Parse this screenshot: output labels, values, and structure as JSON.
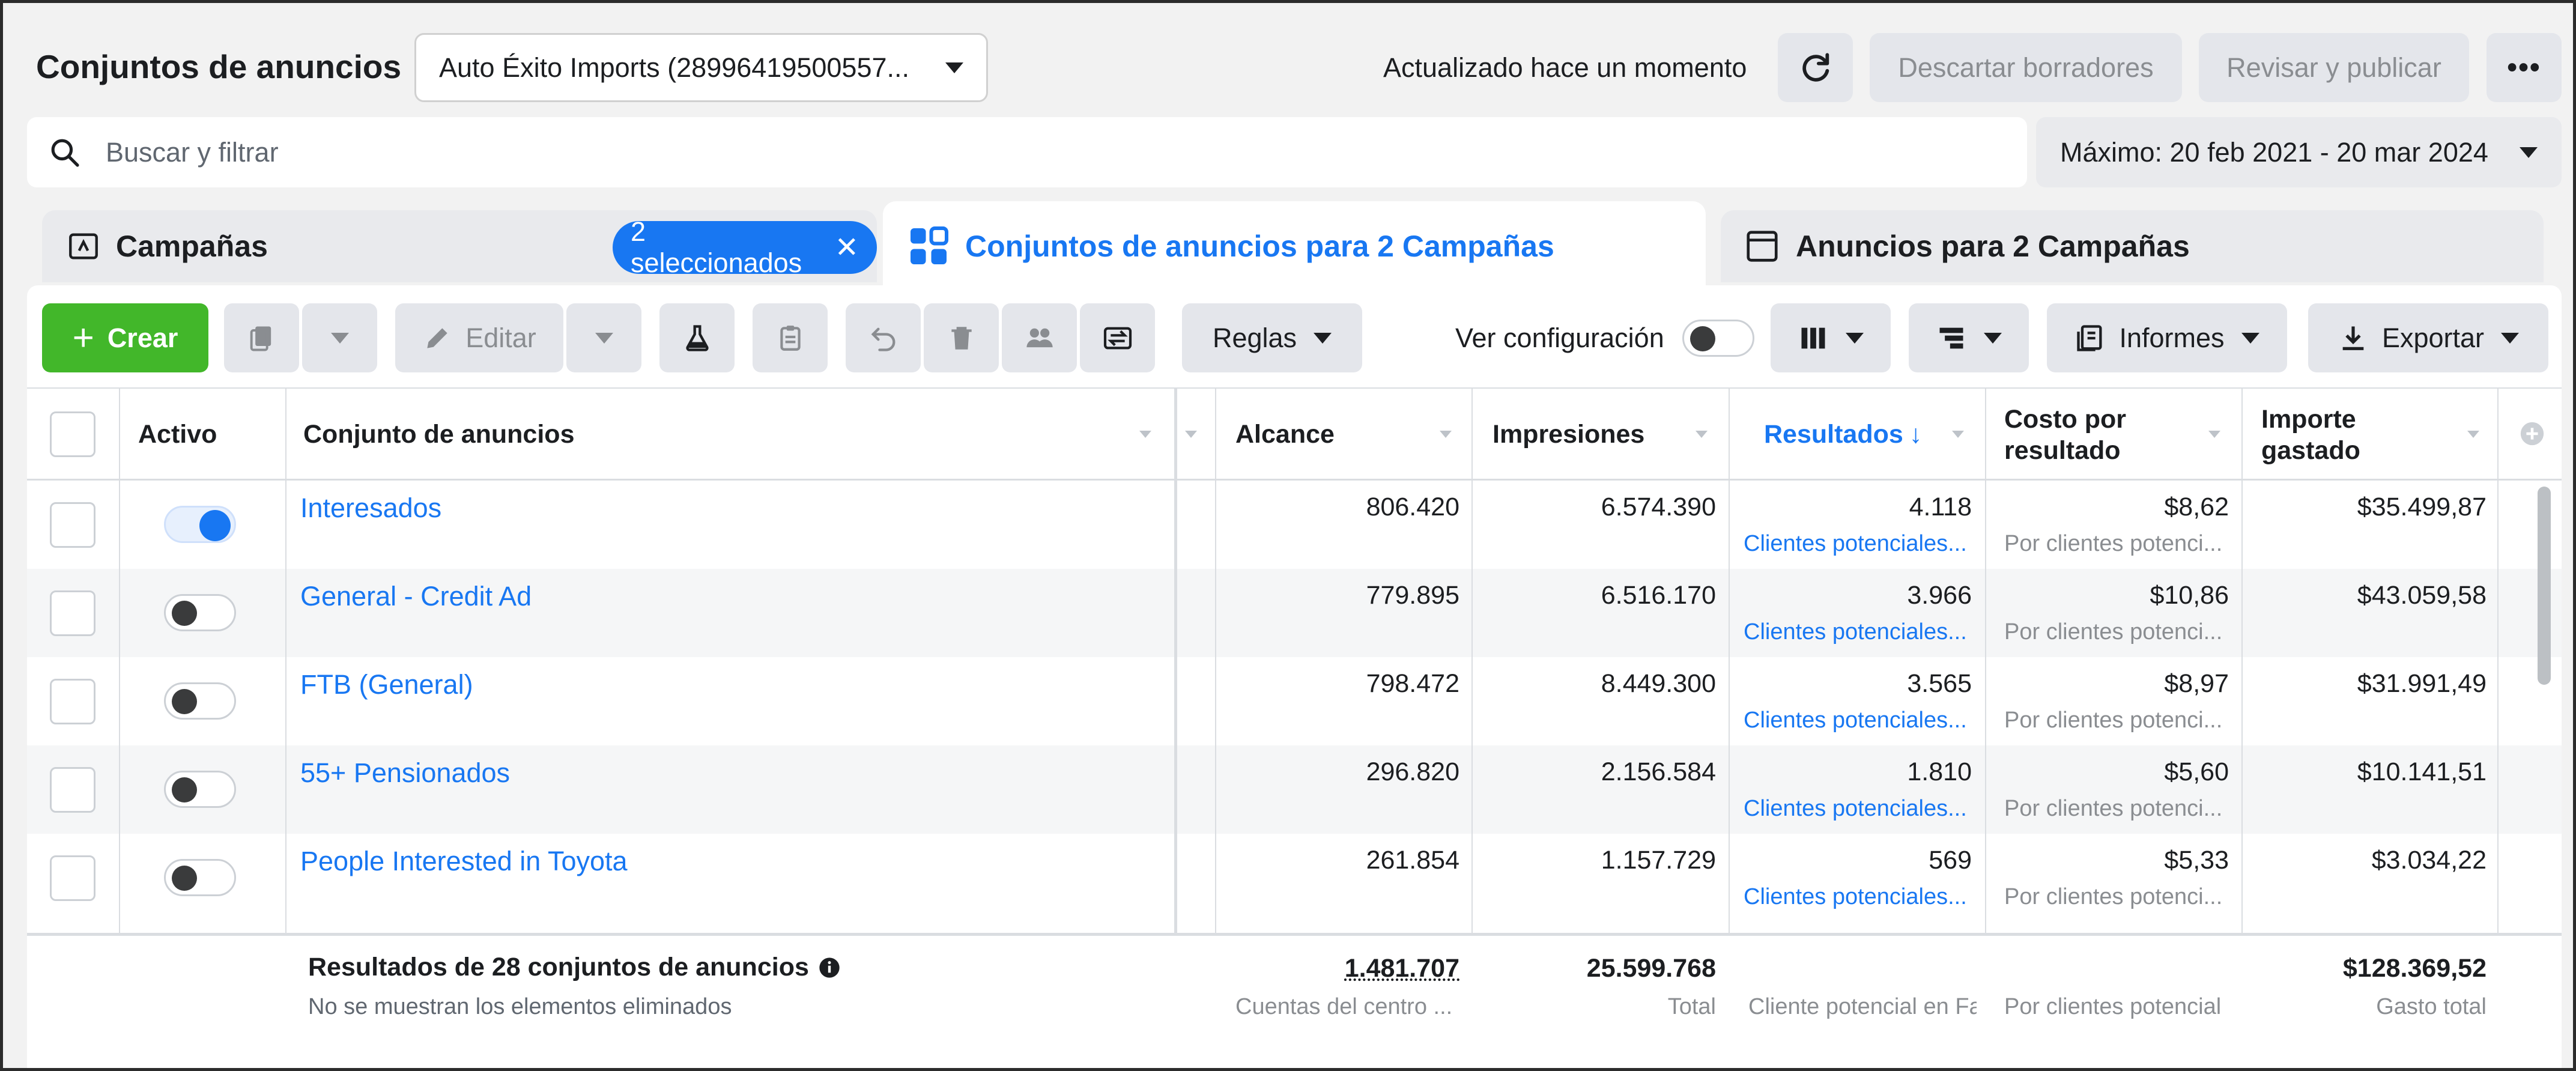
{
  "header": {
    "title": "Conjuntos de anuncios",
    "account": "Auto Éxito Imports (28996419500557...",
    "updated": "Actualizado hace un momento",
    "discard_label": "Descartar borradores",
    "publish_label": "Revisar y publicar"
  },
  "search": {
    "placeholder": "Buscar y filtrar",
    "date_range": "Máximo: 20 feb 2021 - 20 mar 2024"
  },
  "tabs": {
    "campaigns": "Campañas",
    "selected_chip": "2 seleccionados",
    "adsets": "Conjuntos de anuncios para 2 Campañas",
    "ads": "Anuncios para 2 Campañas"
  },
  "toolbar": {
    "create": "Crear",
    "edit": "Editar",
    "rules": "Reglas",
    "view_setup": "Ver configuración",
    "reports": "Informes",
    "export": "Exportar"
  },
  "columns": {
    "active": "Activo",
    "adset": "Conjunto de anuncios",
    "reach": "Alcance",
    "impressions": "Impresiones",
    "results": "Resultados",
    "cost_l1": "Costo por",
    "cost_l2": "resultado",
    "spent_l1": "Importe",
    "spent_l2": "gastado"
  },
  "rows": [
    {
      "active": true,
      "name": "Interesados",
      "reach": "806.420",
      "impressions": "6.574.390",
      "results": "4.118",
      "results_sub": "Clientes potenciales...",
      "cost": "$8,62",
      "cost_sub": "Por clientes potenci...",
      "spent": "$35.499,87"
    },
    {
      "active": false,
      "name": "General - Credit Ad",
      "reach": "779.895",
      "impressions": "6.516.170",
      "results": "3.966",
      "results_sub": "Clientes potenciales...",
      "cost": "$10,86",
      "cost_sub": "Por clientes potenci...",
      "spent": "$43.059,58"
    },
    {
      "active": false,
      "name": "FTB (General)",
      "reach": "798.472",
      "impressions": "8.449.300",
      "results": "3.565",
      "results_sub": "Clientes potenciales...",
      "cost": "$8,97",
      "cost_sub": "Por clientes potenci...",
      "spent": "$31.991,49"
    },
    {
      "active": false,
      "name": "55+ Pensionados",
      "reach": "296.820",
      "impressions": "2.156.584",
      "results": "1.810",
      "results_sub": "Clientes potenciales...",
      "cost": "$5,60",
      "cost_sub": "Por clientes potenci...",
      "spent": "$10.141,51"
    },
    {
      "active": false,
      "name": "People Interested in Toyota",
      "reach": "261.854",
      "impressions": "1.157.729",
      "results": "569",
      "results_sub": "Clientes potenciales...",
      "cost": "$5,33",
      "cost_sub": "Por clientes potenci...",
      "spent": "$3.034,22"
    }
  ],
  "footer": {
    "title": "Resultados de 28 conjuntos de anuncios",
    "subtitle": "No se muestran los elementos eliminados",
    "reach": "1.481.707",
    "reach_sub": "Cuentas del centro ...",
    "impressions": "25.599.768",
    "impressions_sub": "Total",
    "results_sub": "Cliente potencial en Fa",
    "cost_sub": "Por clientes potencial",
    "spent": "$128.369,52",
    "spent_sub": "Gasto total"
  },
  "colors": {
    "accent": "#1877f2",
    "create": "#42b72a"
  }
}
